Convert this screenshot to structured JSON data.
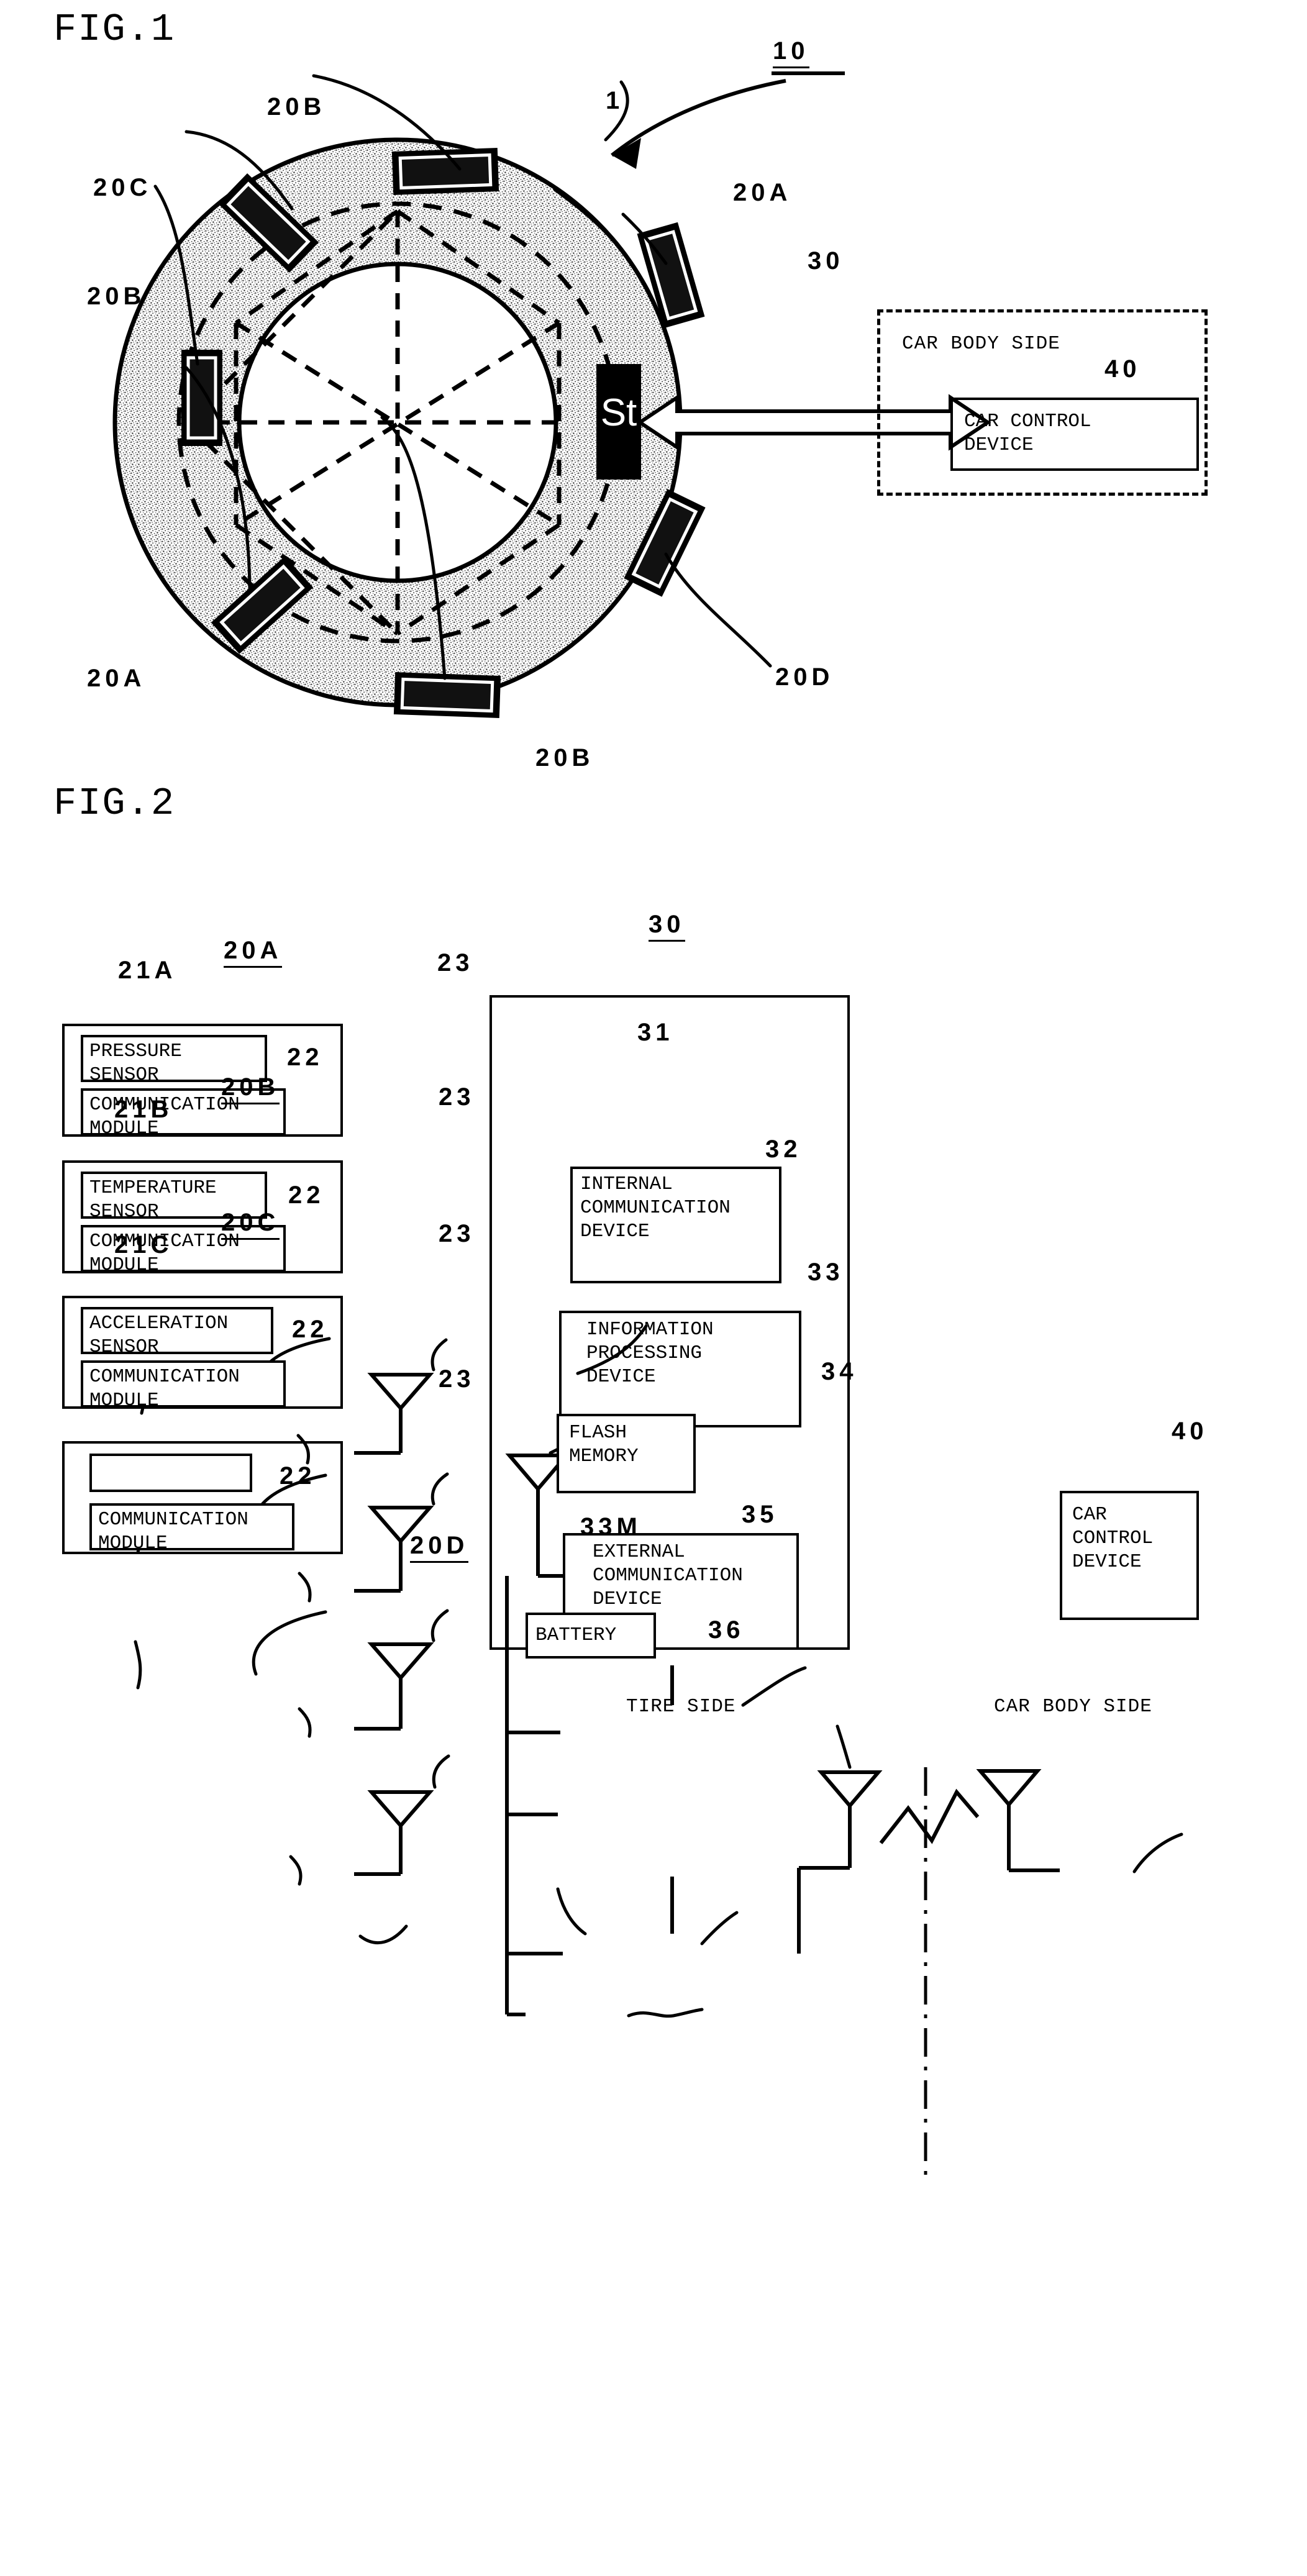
{
  "figures": [
    {
      "id": "fig1",
      "title": "FIG.1",
      "refs": {
        "tire": "1",
        "system": "10",
        "sensor_a_top": "20A",
        "sensor_b_top": "20B",
        "sensor_b_left": "20B",
        "sensor_b_bottom": "20B",
        "sensor_c": "20C",
        "sensor_a_bottom": "20A",
        "sensor_d": "20D",
        "tire_unit": "30",
        "car_control": "40"
      },
      "st_block_label": "St",
      "car_body_side_label": "CAR BODY SIDE",
      "car_control_device_label": "CAR CONTROL\nDEVICE"
    },
    {
      "id": "fig2",
      "title": "FIG.2",
      "sensor_modules": [
        {
          "module_ref": "20A",
          "sensor_ref": "21A",
          "sensor_label": "PRESSURE\nSENSOR",
          "comm_ref": "22",
          "comm_label": "COMMUNICATION\nMODULE",
          "antenna_ref": "23"
        },
        {
          "module_ref": "20B",
          "sensor_ref": "21B",
          "sensor_label": "TEMPERATURE\nSENSOR",
          "comm_ref": "22",
          "comm_label": "COMMUNICATION\nMODULE",
          "antenna_ref": "23"
        },
        {
          "module_ref": "20C",
          "sensor_ref": "21C",
          "sensor_label": "ACCELERATION\nSENSOR",
          "comm_ref": "22",
          "comm_label": "COMMUNICATION\nMODULE",
          "antenna_ref": "23"
        },
        {
          "module_ref": "20D",
          "sensor_ref": "",
          "sensor_label": "",
          "comm_ref": "22",
          "comm_label": "COMMUNICATION\nMODULE",
          "antenna_ref": "23"
        }
      ],
      "unit": {
        "unit_ref": "30",
        "antenna_internal_ref": "31",
        "internal_comm_ref": "32",
        "internal_comm_label": "INTERNAL\nCOMMUNICATION\nDEVICE",
        "info_proc_ref": "33",
        "info_proc_label": "INFORMATION\nPROCESSING\nDEVICE",
        "flash_memory_ref": "33M",
        "flash_memory_label": "FLASH\nMEMORY",
        "external_comm_ref": "35",
        "external_comm_label": "EXTERNAL\nCOMMUNICATION\nDEVICE",
        "antenna_external_ref": "34",
        "battery_ref": "36",
        "battery_label": "BATTERY"
      },
      "car_side": {
        "car_control_ref": "40",
        "car_control_label": "CAR\nCONTROL\nDEVICE"
      },
      "side_labels": {
        "tire_side": "TIRE SIDE",
        "car_body_side": "CAR BODY SIDE"
      }
    }
  ]
}
